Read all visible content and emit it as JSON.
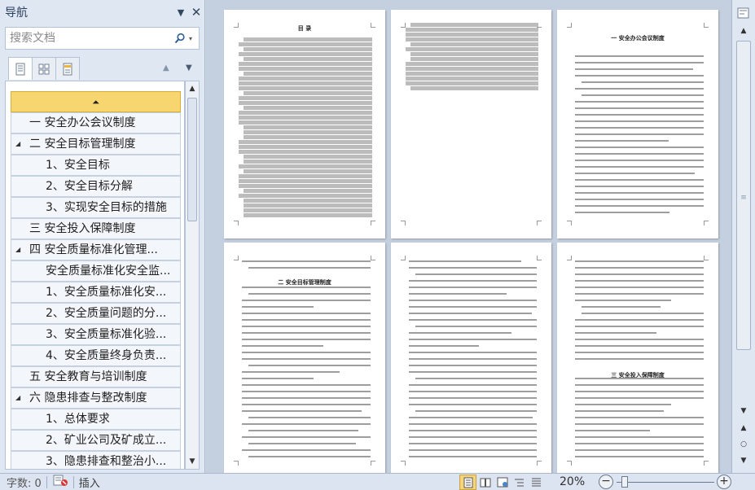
{
  "nav": {
    "title": "导航",
    "search_placeholder": "搜索文档",
    "headings": [
      {
        "label": "",
        "level": 0,
        "active": true,
        "toggle": false
      },
      {
        "label": "一 安全办公会议制度",
        "level": 1,
        "active": false,
        "toggle": false
      },
      {
        "label": "二 安全目标管理制度",
        "level": 1,
        "active": false,
        "toggle": true
      },
      {
        "label": "1、安全目标",
        "level": 2,
        "active": false,
        "toggle": false
      },
      {
        "label": "2、安全目标分解",
        "level": 2,
        "active": false,
        "toggle": false
      },
      {
        "label": "3、实现安全目标的措施",
        "level": 2,
        "active": false,
        "toggle": false
      },
      {
        "label": "三 安全投入保障制度",
        "level": 1,
        "active": false,
        "toggle": false
      },
      {
        "label": "四 安全质量标准化管理...",
        "level": 1,
        "active": false,
        "toggle": true
      },
      {
        "label": "安全质量标准化安全监...",
        "level": 2,
        "active": false,
        "toggle": false
      },
      {
        "label": "1、安全质量标准化安...",
        "level": 2,
        "active": false,
        "toggle": false
      },
      {
        "label": "2、安全质量问题的分...",
        "level": 2,
        "active": false,
        "toggle": false
      },
      {
        "label": "3、安全质量标准化验...",
        "level": 2,
        "active": false,
        "toggle": false
      },
      {
        "label": "4、安全质量终身负责...",
        "level": 2,
        "active": false,
        "toggle": false
      },
      {
        "label": "五 安全教育与培训制度",
        "level": 1,
        "active": false,
        "toggle": false
      },
      {
        "label": "六 隐患排查与整改制度",
        "level": 1,
        "active": false,
        "toggle": true
      },
      {
        "label": "1、总体要求",
        "level": 2,
        "active": false,
        "toggle": false
      },
      {
        "label": "2、矿业公司及矿成立...",
        "level": 2,
        "active": false,
        "toggle": false
      },
      {
        "label": "3、隐患排查和整治小...",
        "level": 2,
        "active": false,
        "toggle": false
      }
    ],
    "icons": {
      "active_heading": "collapse-up-icon",
      "toggle": "expanded-triangle-icon",
      "search": "search-icon",
      "tabs": [
        "headings-view-icon",
        "pages-view-icon",
        "results-view-icon"
      ]
    }
  },
  "pages": [
    {
      "title": "目 录"
    },
    {
      "title": ""
    },
    {
      "title": "一 安全办公会议制度"
    },
    {
      "title": "二 安全目标管理制度"
    },
    {
      "title": ""
    },
    {
      "title": "三 安全投入保障制度"
    }
  ],
  "status": {
    "word_count": "字数: 0",
    "mode": "插入",
    "zoom": "20%"
  },
  "colors": {
    "active_heading": "#f7d56f",
    "pane_bg": "#dfe7f2",
    "doc_bg": "#c4d0df"
  }
}
